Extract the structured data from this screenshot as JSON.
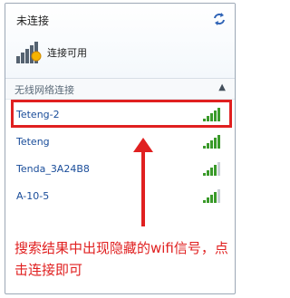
{
  "status": {
    "title": "未连接",
    "connection_label": "连接可用",
    "refresh_icon": "refresh-icon",
    "connection_icon": "signal-bars-sun-icon"
  },
  "section": {
    "title": "无线网络连接",
    "collapse_icon": "chevron-up-icon",
    "collapse_glyph": "▲"
  },
  "networks": [
    {
      "name": "Teteng-2",
      "signal_bars": 5
    },
    {
      "name": "Teteng",
      "signal_bars": 5
    },
    {
      "name": "Tenda_3A24B8",
      "signal_bars": 4
    },
    {
      "name": "A-10-5",
      "signal_bars": 4
    }
  ],
  "annotation": {
    "text": "搜索结果中出现隐藏的wifi信号，点击连接即可",
    "color": "#e02020"
  },
  "colors": {
    "network_text": "#1a4d9a",
    "signal_green": "#3a9a2a",
    "signal_gray": "#c9cfd6"
  }
}
